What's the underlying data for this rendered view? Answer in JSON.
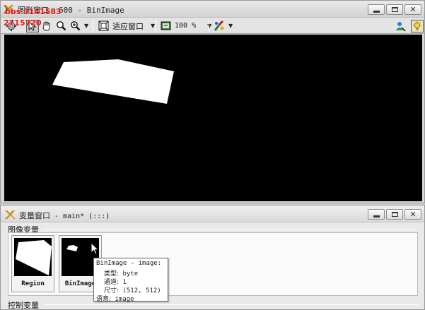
{
  "graphics_window": {
    "title_prefix": "图形窗口",
    "title_suffix": "600 - BinImage",
    "watermark_line1": "bbs 3141583",
    "watermark_line2": "2715720",
    "zoom_label": "适应窗口",
    "zoom_percent": "100 %",
    "icons": [
      "settings-gear-icon",
      "pointer-select-icon",
      "hand-pan-icon",
      "zoom-icon",
      "zoom-in-icon",
      "zoom-fit-icon",
      "zoom-percent-icon",
      "color-palette-icon",
      "image-properties-icon",
      "lightbulb-icon"
    ]
  },
  "variable_window": {
    "title_cjk": "变量窗口",
    "title_mono": " - main* (:::)",
    "image_vars_label": "图像变量",
    "control_vars_label": "控制变量",
    "thumbnails": [
      {
        "name": "Region"
      },
      {
        "name": "BinImage"
      }
    ],
    "tooltip": {
      "header": "BinImage - image:",
      "type_label": "类型:",
      "type_value": "byte",
      "channels_label": "通道:",
      "channels_value": "1",
      "size_label": "尺寸:",
      "size_value": "(512, 512)",
      "semantic_label": "语意:",
      "semantic_value": "image"
    }
  },
  "colors": {
    "canvas": "#000000",
    "region": "#ffffff",
    "watermark": "#e01010",
    "chrome": "#d6d6d6"
  }
}
